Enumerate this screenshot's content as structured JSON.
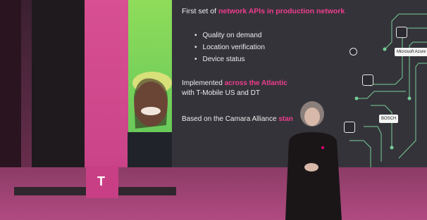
{
  "slide": {
    "title_prefix": "First set of ",
    "title_highlight": "network APIs in production network",
    "bullets": [
      "Quality on demand",
      "Location verification",
      "Device status"
    ],
    "implemented_prefix": "Implemented ",
    "implemented_highlight": "across the Atlantic",
    "implemented_line2": "with T-Mobile US and DT",
    "based_prefix": "Based on the Camara Alliance ",
    "based_highlight": "stan"
  },
  "diagram": {
    "label_top": "Microsoft Azure",
    "label_mid": "BOSCH"
  },
  "brand": {
    "logo_text": "T"
  },
  "colors": {
    "magenta": "#e20074",
    "green": "#6fd05a",
    "slide_bg": "#35333a"
  }
}
